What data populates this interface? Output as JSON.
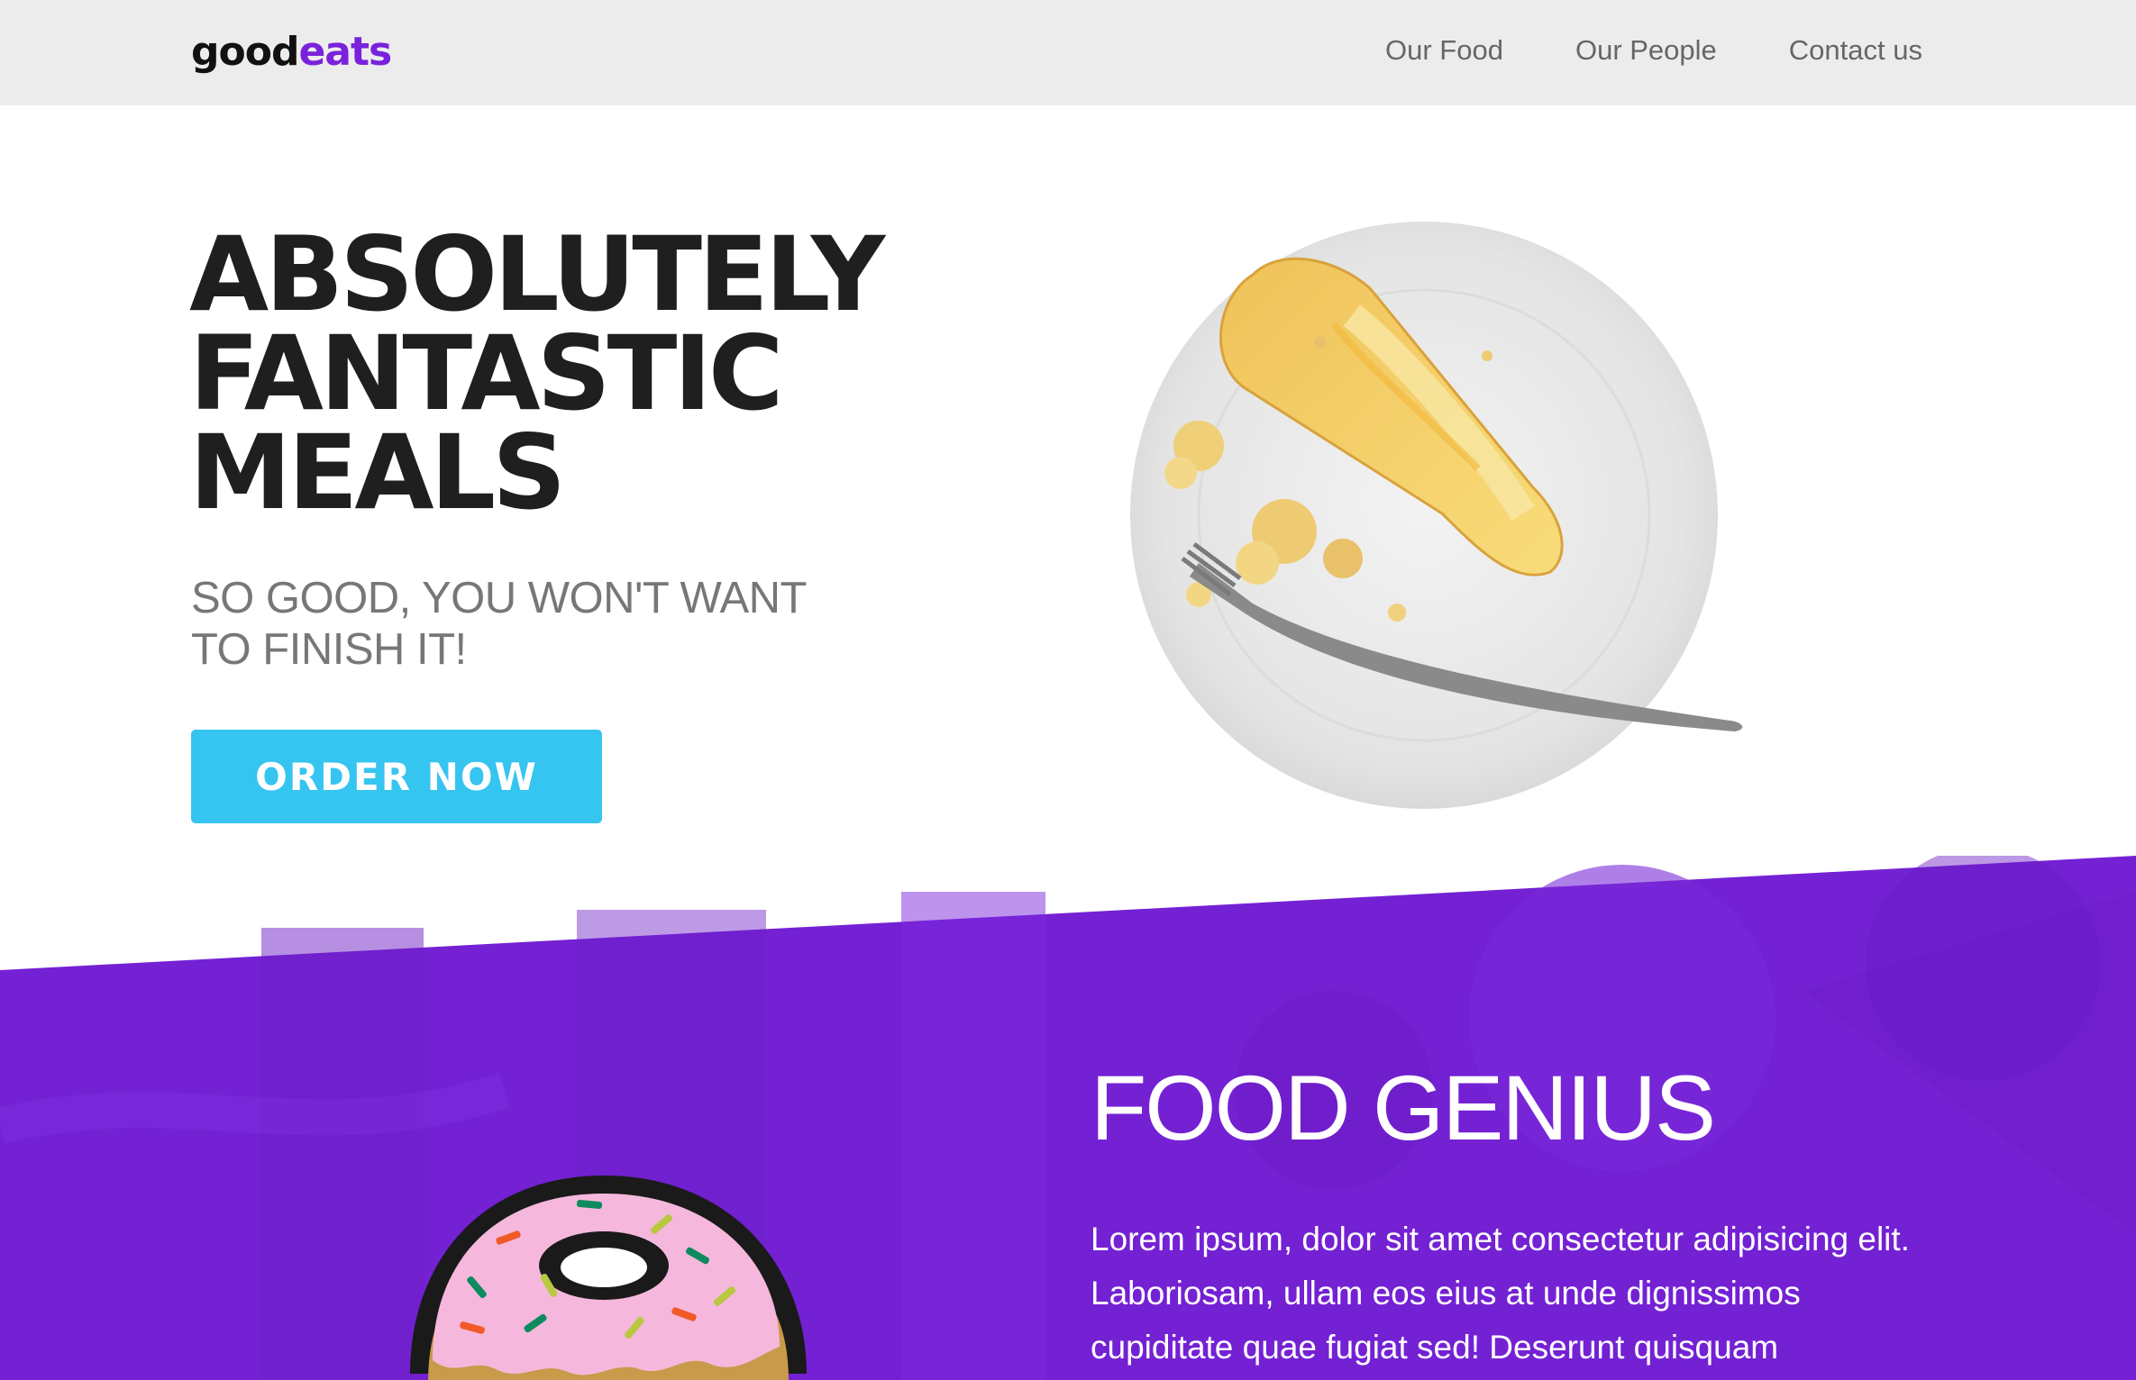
{
  "navbar": {
    "logo_good": "good",
    "logo_eats": "eats",
    "links": [
      {
        "label": "Our Food"
      },
      {
        "label": "Our People"
      },
      {
        "label": "Contact us"
      }
    ]
  },
  "hero": {
    "title_lines": [
      "ABSOLUTELY",
      "FANTASTIC",
      "MEALS"
    ],
    "subtitle": "SO GOOD, YOU WON'T WANT TO FINISH IT!",
    "cta_label": "ORDER NOW",
    "image_icon": "cheesecake-plate-image"
  },
  "genius": {
    "title": "FOOD GENIUS",
    "body": "Lorem ipsum, dolor sit amet consectetur adipisicing elit. Laboriosam, ullam eos eius at unde dignissimos cupiditate quae fugiat sed! Deserunt quisquam",
    "illustration_icon": "donut-icon"
  },
  "colors": {
    "brand_purple": "#7a22db",
    "section_purple": "#7421d4",
    "cta_blue": "#36c4f1",
    "nav_bg": "#ececec",
    "heading_dark": "#1f1f1f",
    "subtitle_gray": "#777777"
  }
}
